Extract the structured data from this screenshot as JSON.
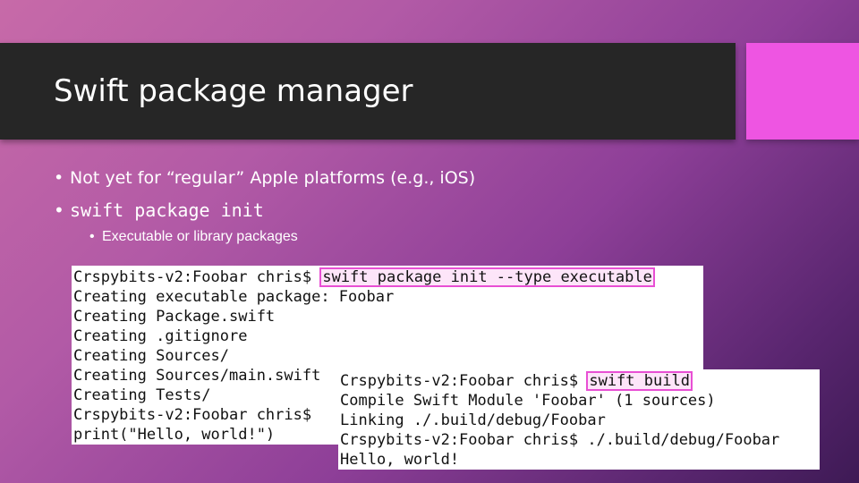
{
  "slide": {
    "title": "Swift package manager",
    "bullets": {
      "b1": "Not yet for “regular” Apple platforms (e.g., iOS)",
      "b2": "swift package init",
      "b3": "Executable or library packages"
    },
    "bullet_glyph": "•"
  },
  "terminal1": {
    "line1_prompt": "Crspybits-v2:Foobar chris$ ",
    "line1_cmd": "swift package init --type executable",
    "line2": "Creating executable package: Foobar",
    "line3": "Creating Package.swift",
    "line4": "Creating .gitignore",
    "line5": "Creating Sources/",
    "line6": "Creating Sources/main.swift",
    "line7": "Creating Tests/",
    "line8": "Crspybits-v2:Foobar chris$",
    "line9": "print(\"Hello, world!\")"
  },
  "terminal2": {
    "line1_prompt": "Crspybits-v2:Foobar chris$ ",
    "line1_cmd": "swift build",
    "line2": "Compile Swift Module 'Foobar' (1 sources)",
    "line3": "Linking ./.build/debug/Foobar",
    "line4": "Crspybits-v2:Foobar chris$ ./.build/debug/Foobar",
    "line5": "Hello, world!"
  },
  "colors": {
    "title_bar": "#262626",
    "accent": "#ee55e2",
    "highlight_border": "#e84fd4"
  }
}
